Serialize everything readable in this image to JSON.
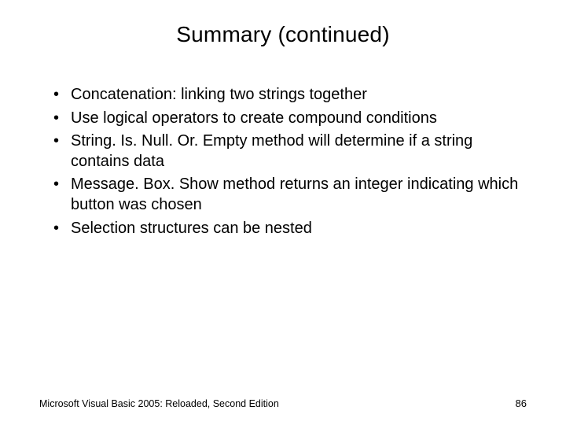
{
  "title": "Summary (continued)",
  "bullets": [
    "Concatenation: linking two strings together",
    "Use logical operators to create compound conditions",
    "String. Is. Null. Or. Empty method will determine if a string contains data",
    "Message. Box. Show method returns an integer indicating which button was chosen",
    "Selection structures can be nested"
  ],
  "footer": {
    "left": "Microsoft Visual Basic 2005: Reloaded, Second Edition",
    "right": "86"
  }
}
